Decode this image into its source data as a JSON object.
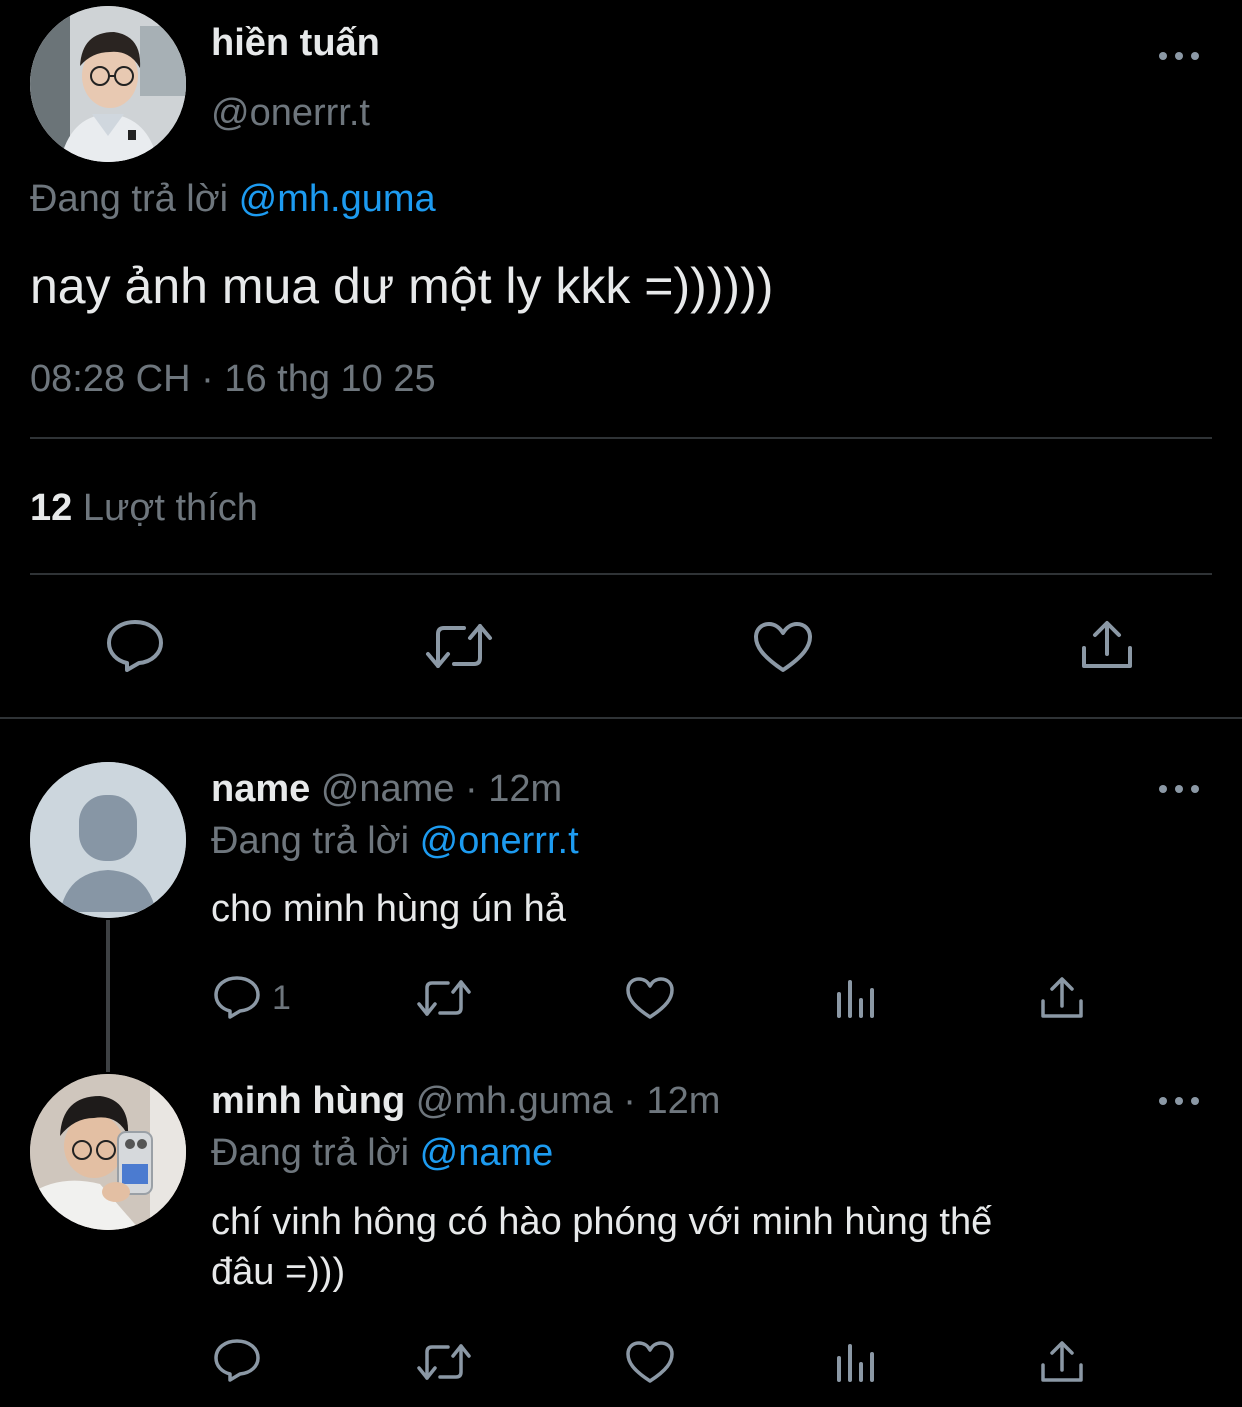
{
  "main_tweet": {
    "display_name": "hiền tuấn",
    "handle": "@onerrr.t",
    "replying_prefix": "Đang trả lời",
    "replying_to": "@mh.guma",
    "text": "nay ảnh mua dư một ly kkk =))))))",
    "timestamp": "08:28 CH · 16 thg 10 25",
    "likes_count": "12",
    "likes_label": "Lượt thích"
  },
  "replies": [
    {
      "display_name": "name",
      "handle": "@name",
      "time": "· 12m",
      "replying_prefix": "Đang trả lời",
      "replying_to": "@onerrr.t",
      "text": "cho minh hùng ún hả",
      "reply_count": "1"
    },
    {
      "display_name": "minh hùng",
      "handle": "@mh.guma",
      "time": "· 12m",
      "replying_prefix": "Đang trả lời",
      "replying_to": "@name",
      "text_line1": "chí vinh hông có hào phóng với minh hùng thế",
      "text_line2": "đâu =)))",
      "reply_count": ""
    }
  ],
  "colors": {
    "background": "#000000",
    "text": "#e7e9ea",
    "muted": "#6e767d",
    "accent": "#1d9bf0",
    "divider": "#2f3336"
  },
  "icons": [
    "more-icon",
    "reply-icon",
    "retweet-icon",
    "like-icon",
    "share-icon",
    "views-icon"
  ]
}
